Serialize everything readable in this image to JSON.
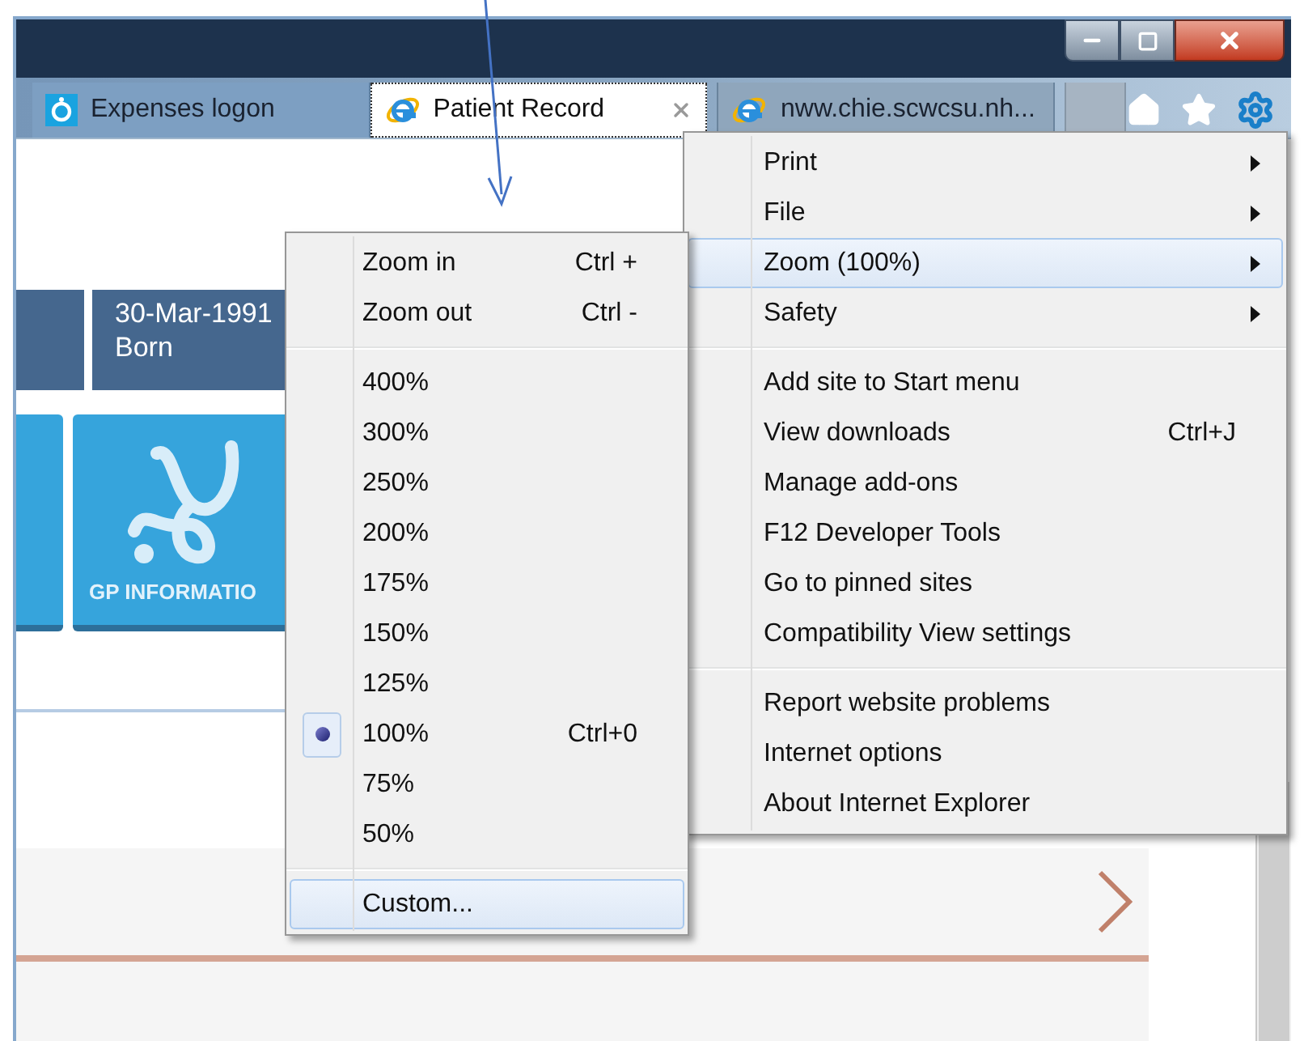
{
  "window": {
    "tabs": [
      {
        "label": "Expenses logon",
        "kind": "ring",
        "selected": false
      },
      {
        "label": "Patient Record",
        "kind": "browser",
        "selected": true
      },
      {
        "label": "nww.chie.scwcsu.nh...",
        "kind": "browser",
        "selected": false
      }
    ]
  },
  "page": {
    "summary_tiles": [
      {
        "kind": "blank"
      },
      {
        "kind": "text",
        "value": "30-Mar-1991",
        "label": "Born"
      }
    ],
    "service_tiles": [
      {
        "kind": "blank"
      },
      {
        "kind": "stethoscope",
        "label": "GP INFORMATIO"
      }
    ]
  },
  "tools_menu": {
    "items": [
      {
        "kind": "item",
        "label": "Print",
        "has_submenu": true,
        "highlighted": false
      },
      {
        "kind": "item",
        "label": "File",
        "has_submenu": true,
        "highlighted": false
      },
      {
        "kind": "item",
        "label": "Zoom (100%)",
        "has_submenu": true,
        "highlighted": true
      },
      {
        "kind": "item",
        "label": "Safety",
        "has_submenu": true,
        "highlighted": false
      },
      {
        "kind": "separator"
      },
      {
        "kind": "item",
        "label": "Add site to Start menu",
        "has_submenu": false,
        "highlighted": false
      },
      {
        "kind": "item",
        "label": "View downloads",
        "shortcut": "Ctrl+J",
        "has_submenu": false,
        "highlighted": false
      },
      {
        "kind": "item",
        "label": "Manage add-ons",
        "has_submenu": false,
        "highlighted": false
      },
      {
        "kind": "item",
        "label": "F12 Developer Tools",
        "has_submenu": false,
        "highlighted": false
      },
      {
        "kind": "item",
        "label": "Go to pinned sites",
        "has_submenu": false,
        "highlighted": false
      },
      {
        "kind": "item",
        "label": "Compatibility View settings",
        "has_submenu": false,
        "highlighted": false
      },
      {
        "kind": "separator"
      },
      {
        "kind": "item",
        "label": "Report website problems",
        "has_submenu": false,
        "highlighted": false
      },
      {
        "kind": "item",
        "label": "Internet options",
        "has_submenu": false,
        "highlighted": false
      },
      {
        "kind": "item",
        "label": "About Internet Explorer",
        "has_submenu": false,
        "highlighted": false
      }
    ]
  },
  "zoom_menu": {
    "items": [
      {
        "kind": "item",
        "label": "Zoom in",
        "shortcut": "Ctrl +",
        "checked": false,
        "highlighted": false
      },
      {
        "kind": "item",
        "label": "Zoom out",
        "shortcut": "Ctrl -",
        "checked": false,
        "highlighted": false
      },
      {
        "kind": "separator"
      },
      {
        "kind": "item",
        "label": "400%",
        "checked": false,
        "highlighted": false
      },
      {
        "kind": "item",
        "label": "300%",
        "checked": false,
        "highlighted": false
      },
      {
        "kind": "item",
        "label": "250%",
        "checked": false,
        "highlighted": false
      },
      {
        "kind": "item",
        "label": "200%",
        "checked": false,
        "highlighted": false
      },
      {
        "kind": "item",
        "label": "175%",
        "checked": false,
        "highlighted": false
      },
      {
        "kind": "item",
        "label": "150%",
        "checked": false,
        "highlighted": false
      },
      {
        "kind": "item",
        "label": "125%",
        "checked": false,
        "highlighted": false
      },
      {
        "kind": "item",
        "label": "100%",
        "shortcut": "Ctrl+0",
        "checked": true,
        "highlighted": false
      },
      {
        "kind": "item",
        "label": "75%",
        "checked": false,
        "highlighted": false
      },
      {
        "kind": "item",
        "label": "50%",
        "checked": false,
        "highlighted": false
      },
      {
        "kind": "separator"
      },
      {
        "kind": "item",
        "label": "Custom...",
        "checked": false,
        "highlighted": true
      }
    ]
  }
}
